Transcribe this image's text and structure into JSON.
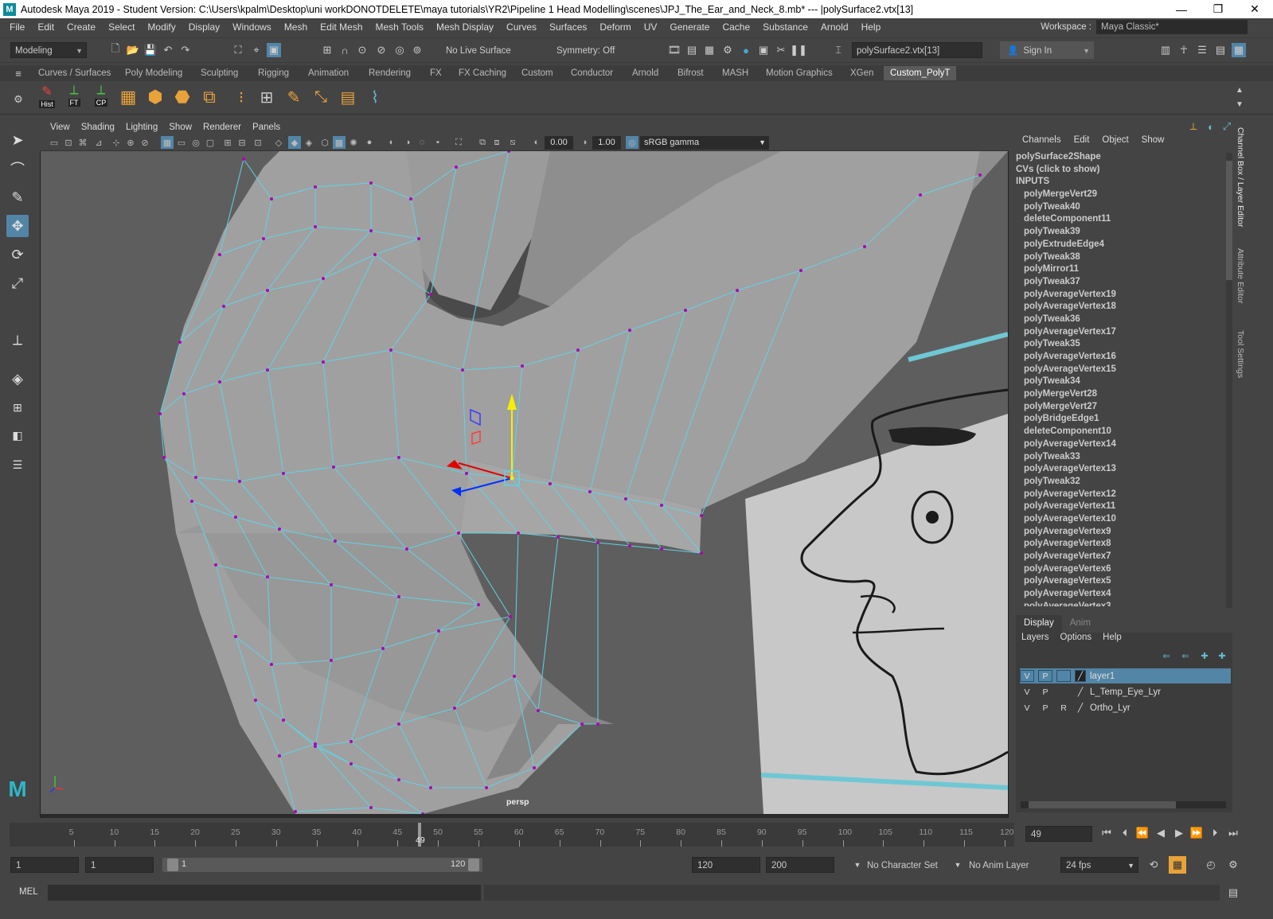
{
  "title": "Autodesk Maya 2019 - Student Version: C:\\Users\\kpalm\\Desktop\\uni workDONOTDELETE\\maya tutorials\\YR2\\Pipeline 1 Head Modelling\\scenes\\JPJ_The_Ear_and_Neck_8.mb*  ---  |polySurface2.vtx[13]",
  "menus": [
    "File",
    "Edit",
    "Create",
    "Select",
    "Modify",
    "Display",
    "Windows",
    "Mesh",
    "Edit Mesh",
    "Mesh Tools",
    "Mesh Display",
    "Curves",
    "Surfaces",
    "Deform",
    "UV",
    "Generate",
    "Cache",
    "Substance",
    "Arnold",
    "Help"
  ],
  "workspace": {
    "label": "Workspace :",
    "value": "Maya Classic*"
  },
  "status": {
    "mode": "Modeling",
    "live_surface": "No Live Surface",
    "symmetry": "Symmetry: Off",
    "selection_field": "polySurface2.vtx[13]",
    "sign_in": "Sign In"
  },
  "shelf_tabs": [
    "Curves / Surfaces",
    "Poly Modeling",
    "Sculpting",
    "Rigging",
    "Animation",
    "Rendering",
    "FX",
    "FX Caching",
    "Custom",
    "Conductor",
    "Arnold",
    "Bifrost",
    "MASH",
    "Motion Graphics",
    "XGen",
    "Custom_PolyT"
  ],
  "shelf_active": "Custom_PolyT",
  "shelf_labels": {
    "hist": "Hist",
    "ft": "FT",
    "cp": "CP"
  },
  "viewport": {
    "menus": [
      "View",
      "Shading",
      "Lighting",
      "Show",
      "Renderer",
      "Panels"
    ],
    "exposure": "0.00",
    "gamma": "1.00",
    "color_space": "sRGB gamma",
    "camera": "persp"
  },
  "channel_box": {
    "menus": [
      "Channels",
      "Edit",
      "Object",
      "Show"
    ],
    "shape": "polySurface2Shape",
    "cvs": "CVs (click to show)",
    "inputs_label": "INPUTS",
    "inputs": [
      "polyMergeVert29",
      "polyTweak40",
      "deleteComponent11",
      "polyTweak39",
      "polyExtrudeEdge4",
      "polyTweak38",
      "polyMirror11",
      "polyTweak37",
      "polyAverageVertex19",
      "polyAverageVertex18",
      "polyTweak36",
      "polyAverageVertex17",
      "polyTweak35",
      "polyAverageVertex16",
      "polyAverageVertex15",
      "polyTweak34",
      "polyMergeVert28",
      "polyMergeVert27",
      "polyBridgeEdge1",
      "deleteComponent10",
      "polyAverageVertex14",
      "polyTweak33",
      "polyAverageVertex13",
      "polyTweak32",
      "polyAverageVertex12",
      "polyAverageVertex11",
      "polyAverageVertex10",
      "polyAverageVertex9",
      "polyAverageVertex8",
      "polyAverageVertex7",
      "polyAverageVertex6",
      "polyAverageVertex5",
      "polyAverageVertex4",
      "polyAverageVertex3"
    ]
  },
  "layer_editor": {
    "tabs": [
      "Display",
      "Anim"
    ],
    "menus": [
      "Layers",
      "Options",
      "Help"
    ],
    "layers": [
      {
        "v": "V",
        "p": "P",
        "r": "",
        "name": "layer1"
      },
      {
        "v": "V",
        "p": "P",
        "r": "",
        "name": "L_Temp_Eye_Lyr"
      },
      {
        "v": "V",
        "p": "P",
        "r": "R",
        "name": "Ortho_Lyr"
      }
    ]
  },
  "side_tabs": [
    "Channel Box / Layer Editor",
    "Attribute Editor",
    "Tool Settings"
  ],
  "timeline": {
    "ticks": [
      "5",
      "10",
      "15",
      "20",
      "25",
      "30",
      "35",
      "40",
      "45",
      "50",
      "55",
      "60",
      "65",
      "70",
      "75",
      "80",
      "85",
      "90",
      "95",
      "100",
      "105",
      "110",
      "115",
      "120"
    ],
    "current_frame": "49",
    "current_field": "49"
  },
  "range": {
    "start": "1",
    "anim_start": "1",
    "slider_start": "1",
    "slider_end": "120",
    "end": "120",
    "anim_end": "200",
    "character_set": "No Character Set",
    "anim_layer": "No Anim Layer",
    "fps": "24 fps"
  },
  "command": {
    "label": "MEL"
  },
  "colors": {
    "accent": "#5285a6",
    "wire": "#5fd3e6",
    "vertex": "#b000b0",
    "mesh": "#9a9a9a"
  }
}
